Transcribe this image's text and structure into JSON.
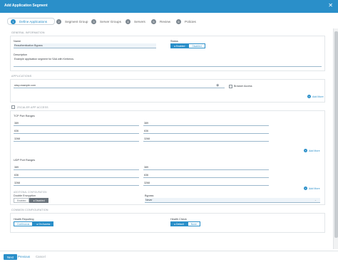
{
  "window": {
    "title": "Add Application Segment",
    "close": "✕"
  },
  "steps": [
    {
      "num": "1",
      "label": "Define Applications"
    },
    {
      "num": "2",
      "label": "Segment Group"
    },
    {
      "num": "3",
      "label": "Server Groups"
    },
    {
      "num": "4",
      "label": "Servers"
    },
    {
      "num": "5",
      "label": "Review"
    },
    {
      "num": "6",
      "label": "Policies"
    }
  ],
  "general": {
    "section_title": "GENERAL INFORMATION",
    "name_label": "Name",
    "name_value": "Reauthentication Bypass",
    "status_label": "Status",
    "status_enabled": "Enabled",
    "status_disabled": "Disabled",
    "description_label": "Description",
    "description_value": "Example application segment for SAA with Kerberos."
  },
  "applications": {
    "section_title": "APPLICATIONS",
    "domain_value": "sbsp.example.com",
    "browser_access_label": "Browser Access",
    "add_more": "Add More"
  },
  "zscaler": {
    "section_title": "ZSCALER APP ACCESS",
    "tcp_label": "TCP Port Ranges",
    "tcp_ports": [
      [
        "389",
        "389"
      ],
      [
        "636",
        "636"
      ],
      [
        "3268",
        "3268"
      ]
    ],
    "udp_label": "UDP Port Ranges",
    "udp_ports": [
      [
        "389",
        "389"
      ],
      [
        "636",
        "636"
      ],
      [
        "3268",
        "3268"
      ]
    ],
    "add_more": "Add More",
    "additional_title": "ADDITIONAL CONFIGURATION",
    "double_encryption_label": "Double Encryption",
    "double_encryption_enabled": "Enabled",
    "double_encryption_disabled": "Disabled",
    "bypass_label": "Bypass",
    "bypass_value": "Never"
  },
  "common": {
    "section_title": "COMMON CONFIGURATION",
    "health_reporting_label": "Health Reporting",
    "health_continuous": "Continuous",
    "health_on_access": "On Access",
    "health_check_label": "Health Check",
    "health_check_default": "Default",
    "health_check_none": "None"
  },
  "footer": {
    "next": "Next",
    "previous": "Previous",
    "cancel": "Cancel"
  },
  "colors": {
    "accent": "#2a8fc9",
    "titlebar": "#2a8fc9"
  },
  "icons": {
    "close": "close-icon",
    "plus": "plus-icon",
    "check": "check-icon",
    "eye": "eye-icon",
    "chevron": "chevron-down-icon"
  }
}
